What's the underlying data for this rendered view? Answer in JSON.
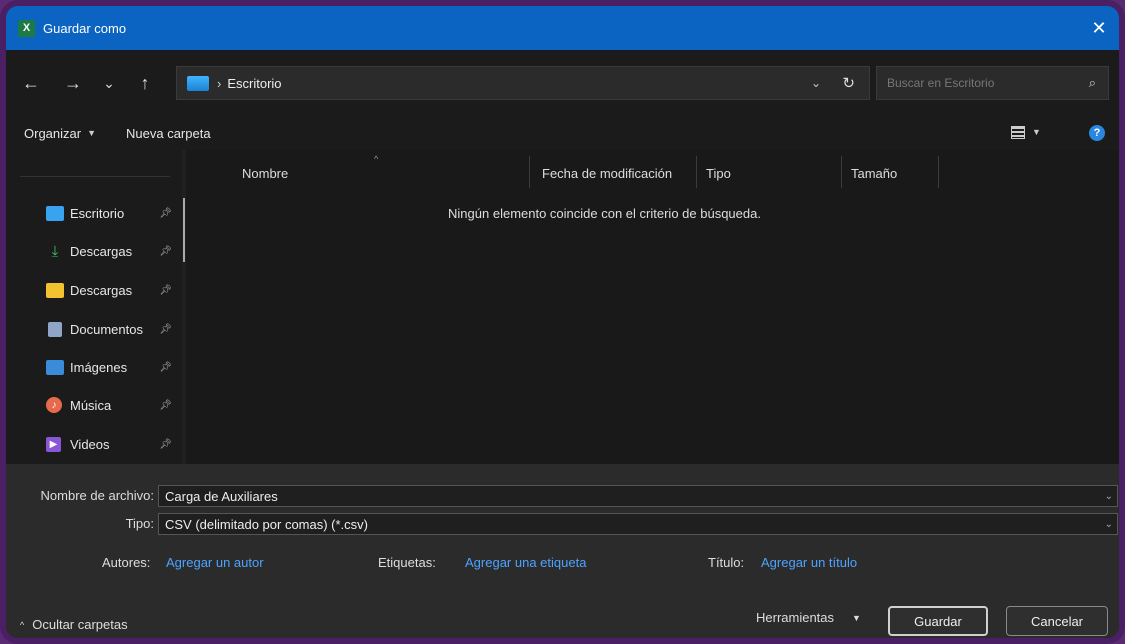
{
  "window": {
    "title": "Guardar como",
    "app_icon": "X",
    "close": "✕"
  },
  "nav": {
    "back": "←",
    "forward": "→",
    "recent": "⌄",
    "up": "↑",
    "separator": "›",
    "path": "Escritorio",
    "refresh": "↻"
  },
  "search": {
    "placeholder": "Buscar en Escritorio"
  },
  "toolbar": {
    "organize": "Organizar",
    "new_folder": "Nueva carpeta"
  },
  "sidebar": {
    "items": [
      {
        "label": "Escritorio",
        "icon": "desktop-folder-icon",
        "color": "#3aa3ef"
      },
      {
        "label": "Descargas",
        "icon": "download-arrow-icon",
        "color": "#3fc45a"
      },
      {
        "label": "Descargas",
        "icon": "yellow-folder-icon",
        "color": "#f2c230"
      },
      {
        "label": "Documentos",
        "icon": "document-icon",
        "color": "#8fa6c9"
      },
      {
        "label": "Imágenes",
        "icon": "image-icon",
        "color": "#3a8bd8"
      },
      {
        "label": "Música",
        "icon": "music-icon",
        "color": "#e86a4d"
      },
      {
        "label": "Videos",
        "icon": "video-icon",
        "color": "#8a56d8"
      }
    ]
  },
  "columns": {
    "name": "Nombre",
    "modified": "Fecha de modificación",
    "type": "Tipo",
    "size": "Tamaño"
  },
  "empty_message": "Ningún elemento coincide con el criterio de búsqueda.",
  "form": {
    "filename_label": "Nombre de archivo:",
    "filename_value": "Carga de Auxiliares",
    "type_label": "Tipo:",
    "type_value": "CSV (delimitado por comas) (*.csv)",
    "authors_label": "Autores:",
    "authors_link": "Agregar un autor",
    "tags_label": "Etiquetas:",
    "tags_link": "Agregar una etiqueta",
    "title_label": "Título:",
    "title_link": "Agregar un título"
  },
  "footer": {
    "hide_folders": "Ocultar carpetas",
    "tools": "Herramientas",
    "save": "Guardar",
    "cancel": "Cancelar"
  },
  "colors": {
    "titlebar": "#0b64c2",
    "link": "#4da3ff",
    "frame": "#4b1f63"
  }
}
